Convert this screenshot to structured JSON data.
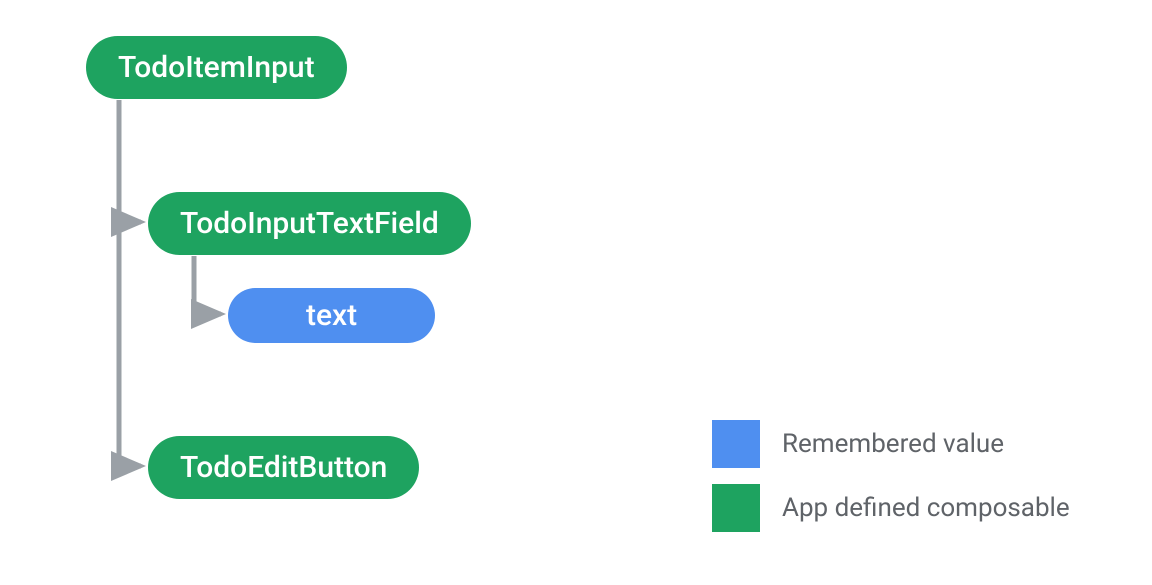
{
  "nodes": {
    "root": "TodoItemInput",
    "field": "TodoInputTextField",
    "text": "text",
    "button": "TodoEditButton"
  },
  "legend": {
    "remembered": "Remembered value",
    "composable": "App defined composable"
  },
  "colors": {
    "green": "#1ea360",
    "blue": "#4f8ff0",
    "connector": "#9aa0a6",
    "legendText": "#5f6368"
  }
}
